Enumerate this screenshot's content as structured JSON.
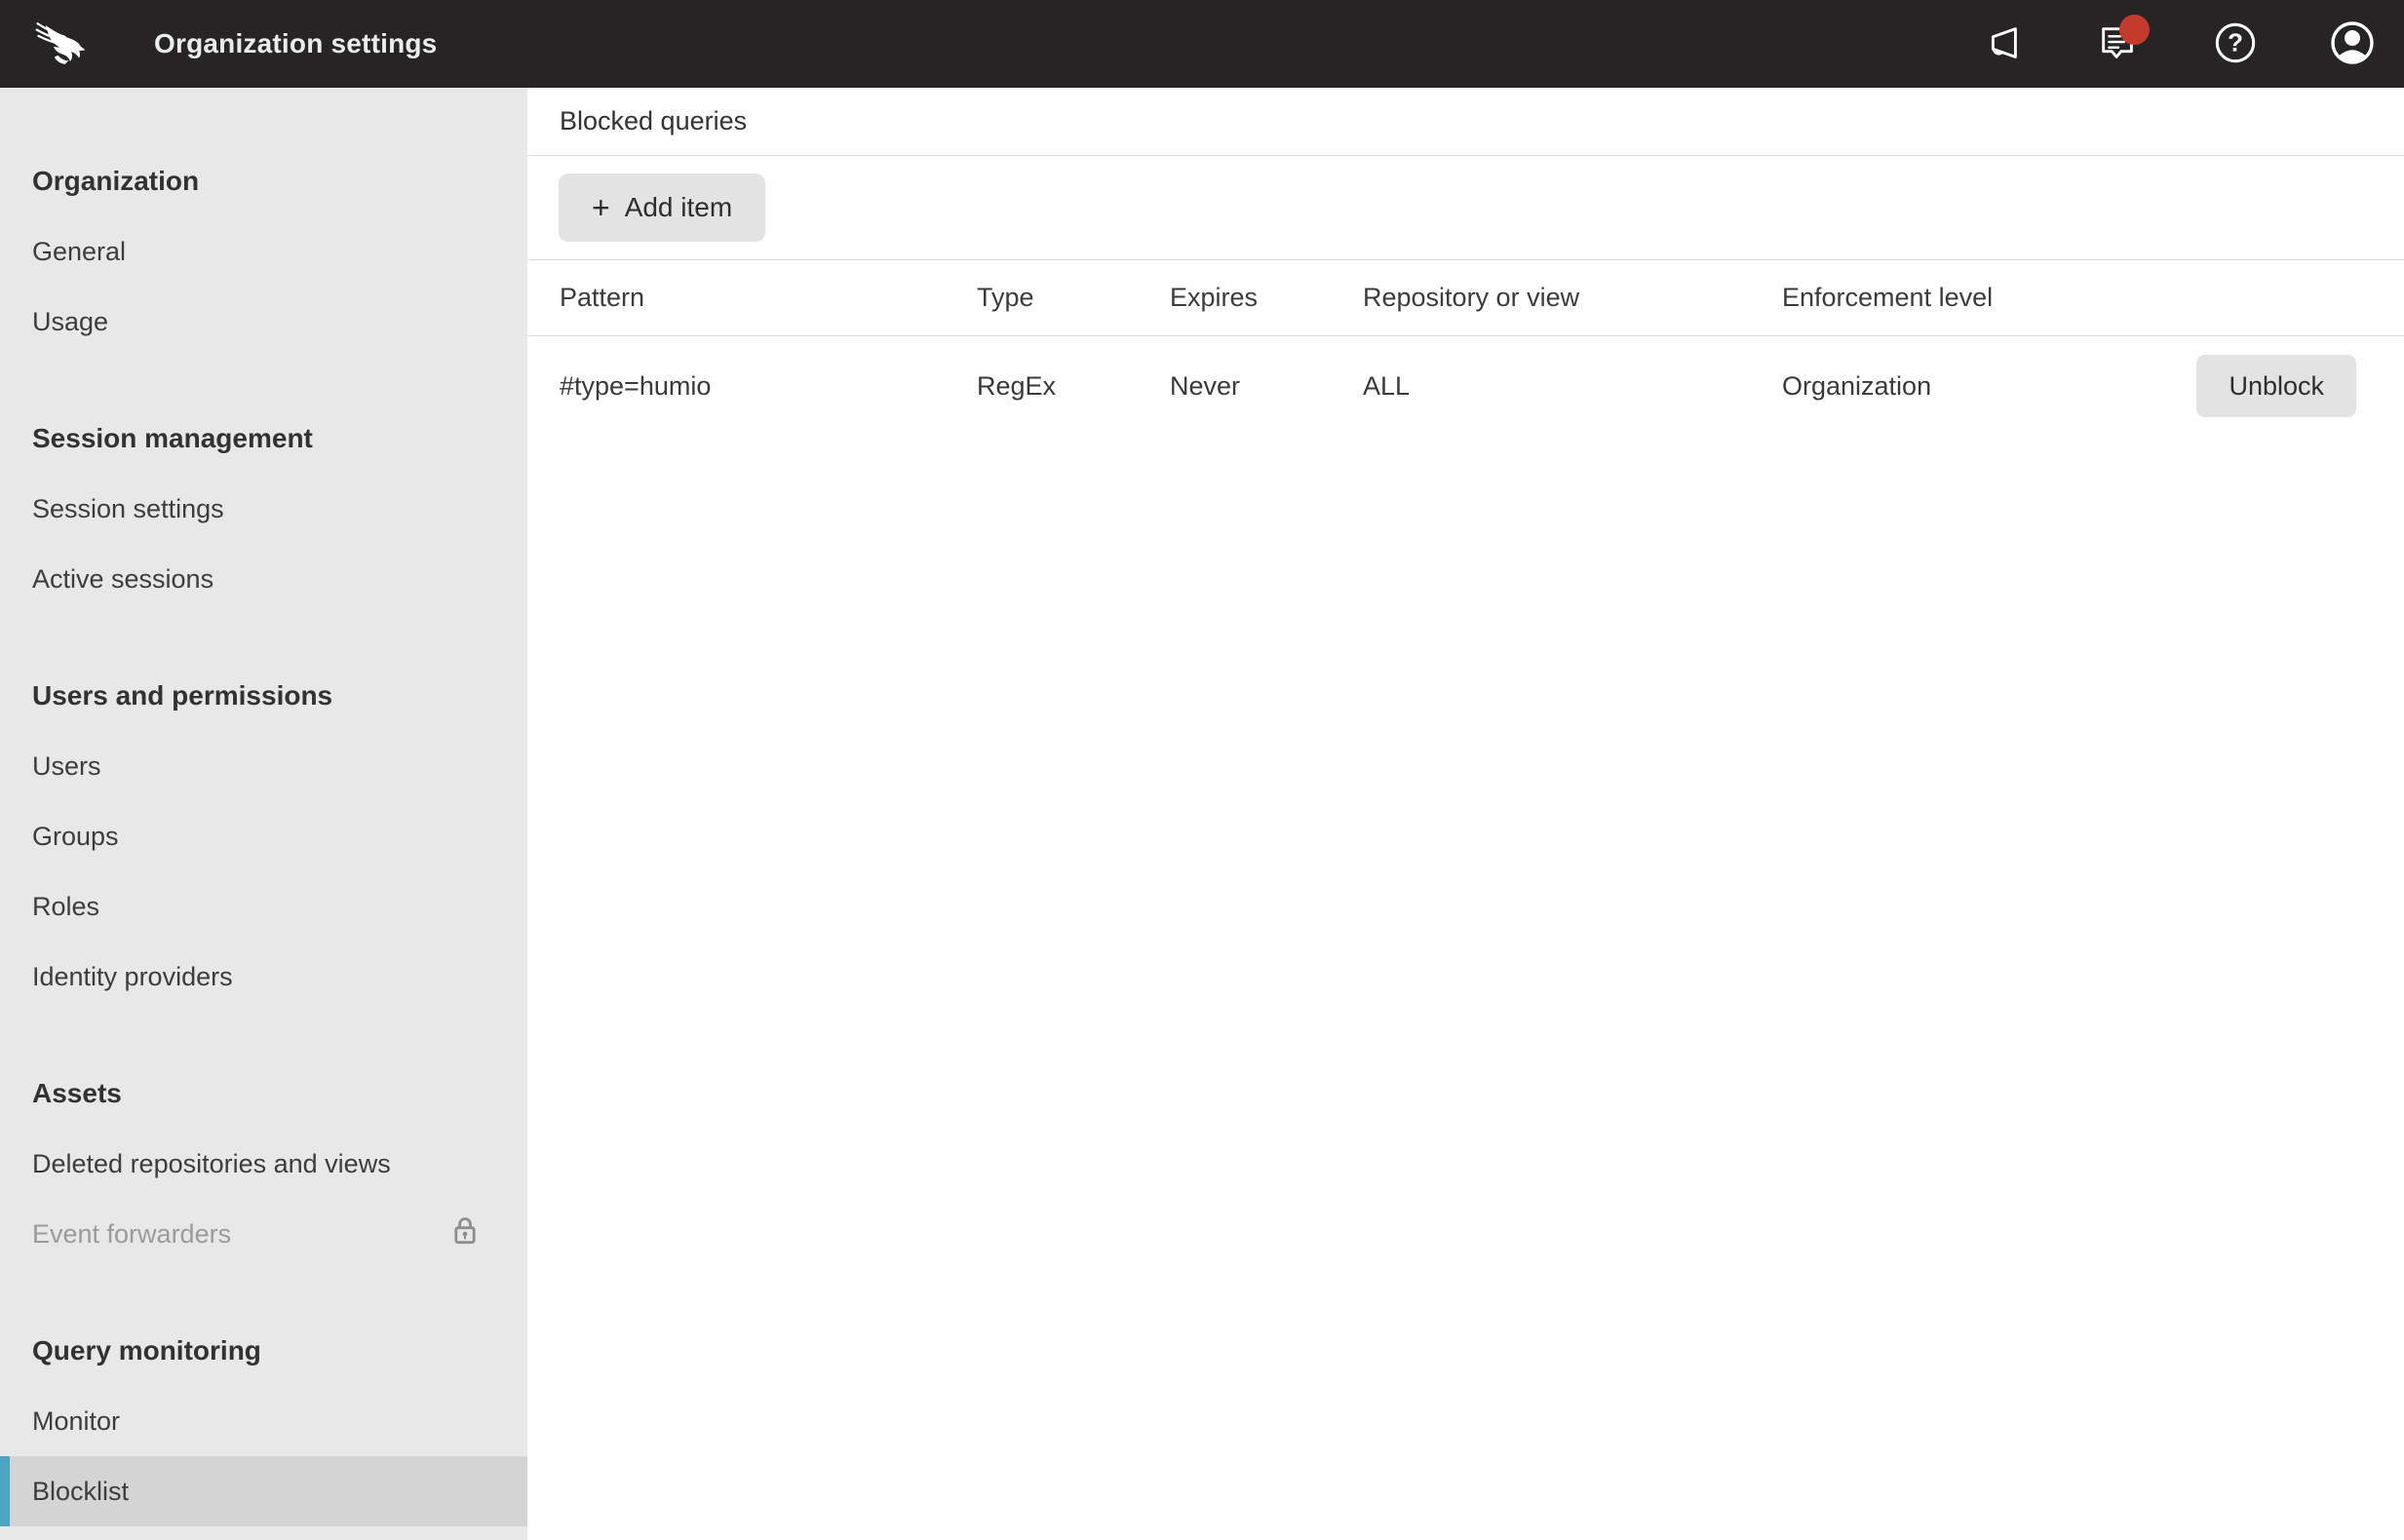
{
  "colors": {
    "accent_teal": "#4BA6C4",
    "notification_red": "#C23B2B",
    "topbar_bg": "#262424",
    "sidebar_bg": "#E9E8E8",
    "selected_item_bg": "#D5D4D4"
  },
  "topbar": {
    "title": "Organization settings",
    "logo_icon": "crowdstrike-falcon",
    "icons": [
      {
        "name": "announcements",
        "glyph": "megaphone"
      },
      {
        "name": "messages",
        "glyph": "chat-bubble",
        "has_unread_dot": true
      },
      {
        "name": "help",
        "glyph": "question-circle"
      },
      {
        "name": "account",
        "glyph": "user-circle"
      }
    ],
    "help_glyph": "?"
  },
  "sidebar": {
    "sections": [
      {
        "header": "Organization",
        "items": [
          {
            "label": "General"
          },
          {
            "label": "Usage"
          }
        ]
      },
      {
        "header": "Session management",
        "items": [
          {
            "label": "Session settings"
          },
          {
            "label": "Active sessions"
          }
        ]
      },
      {
        "header": "Users and permissions",
        "items": [
          {
            "label": "Users"
          },
          {
            "label": "Groups"
          },
          {
            "label": "Roles"
          },
          {
            "label": "Identity providers"
          }
        ]
      },
      {
        "header": "Assets",
        "items": [
          {
            "label": "Deleted repositories and views"
          },
          {
            "label": "Event forwarders",
            "locked": true
          }
        ]
      },
      {
        "header": "Query monitoring",
        "items": [
          {
            "label": "Monitor"
          },
          {
            "label": "Blocklist",
            "selected": true
          }
        ]
      }
    ]
  },
  "main": {
    "title": "Blocked queries",
    "add_item": {
      "plus": "+",
      "label": "Add item"
    },
    "table": {
      "columns": [
        "Pattern",
        "Type",
        "Expires",
        "Repository or view",
        "Enforcement level"
      ],
      "rows": [
        {
          "pattern": "#type=humio",
          "type": "RegEx",
          "expires": "Never",
          "repository_or_view": "ALL",
          "enforcement_level": "Organization",
          "action": "Unblock"
        }
      ]
    }
  }
}
